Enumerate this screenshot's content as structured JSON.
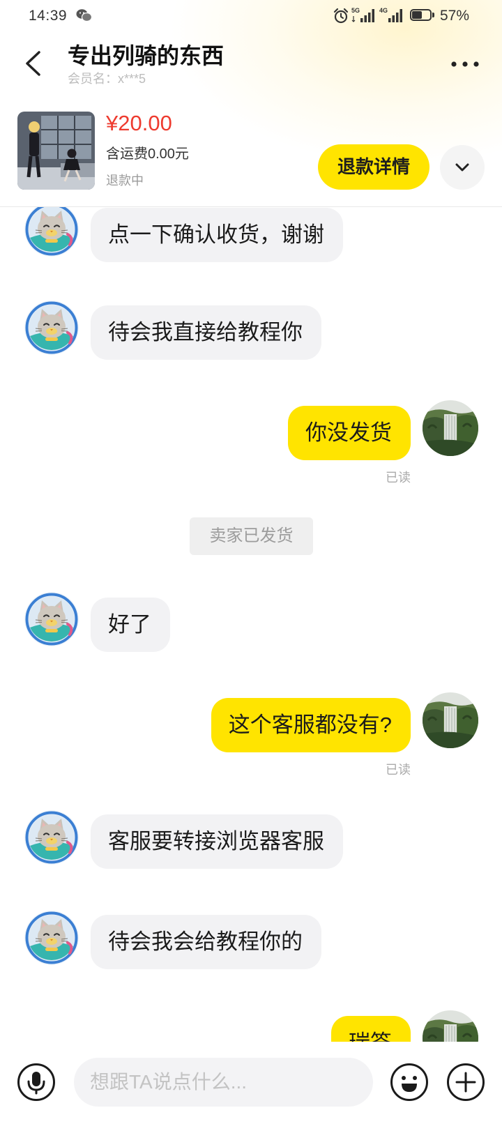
{
  "status_bar": {
    "time": "14:39",
    "network_1": "5G",
    "network_2": "4G",
    "battery": "57%",
    "battery_level": 0.57
  },
  "header": {
    "title": "专出列骑的东西",
    "member_label": "会员名：x***5"
  },
  "product": {
    "price": "¥20.00",
    "shipping": "含运费0.00元",
    "status": "退款中",
    "refund_button": "退款详情"
  },
  "messages": [
    {
      "sender": "seller",
      "text": "点一下确认收货，谢谢"
    },
    {
      "sender": "seller",
      "text": "待会我直接给教程你"
    },
    {
      "sender": "me",
      "text": "你没发货",
      "read_status": "已读"
    },
    {
      "sender": "system",
      "text": "卖家已发货"
    },
    {
      "sender": "seller",
      "text": "好了"
    },
    {
      "sender": "me",
      "text": "这个客服都没有?",
      "read_status": "已读"
    },
    {
      "sender": "seller",
      "text": "客服要转接浏览器客服"
    },
    {
      "sender": "seller",
      "text": "待会我会给教程你的"
    },
    {
      "sender": "me",
      "text": "瑞签"
    }
  ],
  "input": {
    "placeholder": "想跟TA说点什么..."
  },
  "icons": {
    "back": "back-arrow-icon",
    "more": "more-dots-icon",
    "expand": "chevron-down-icon",
    "voice": "microphone-icon",
    "emoji": "emoji-icon",
    "add": "plus-icon",
    "seller_avatar": "cat-avatar",
    "my_avatar": "waterfall-avatar"
  },
  "colors": {
    "accent_yellow": "#ffe400",
    "price_red": "#ee3b2f",
    "seller_bubble": "#f2f2f4",
    "system_bg": "#efefef"
  }
}
